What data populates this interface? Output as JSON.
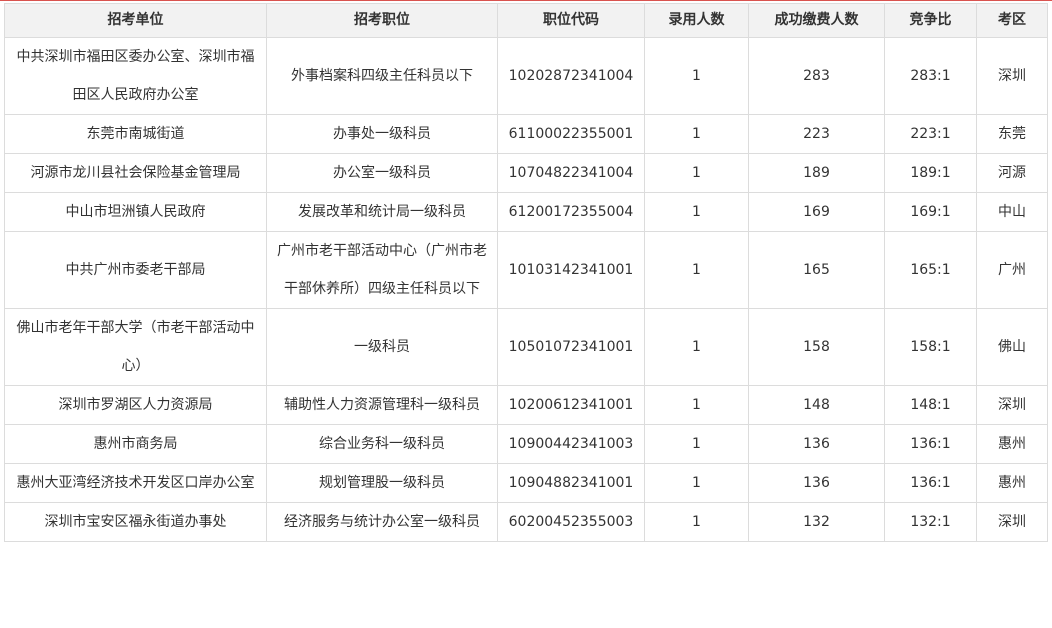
{
  "table": {
    "headers": [
      "招考单位",
      "招考职位",
      "职位代码",
      "录用人数",
      "成功缴费人数",
      "竞争比",
      "考区"
    ],
    "rows": [
      [
        "中共深圳市福田区委办公室、深圳市福田区人民政府办公室",
        "外事档案科四级主任科员以下",
        "10202872341004",
        "1",
        "283",
        "283:1",
        "深圳"
      ],
      [
        "东莞市南城街道",
        "办事处一级科员",
        "61100022355001",
        "1",
        "223",
        "223:1",
        "东莞"
      ],
      [
        "河源市龙川县社会保险基金管理局",
        "办公室一级科员",
        "10704822341004",
        "1",
        "189",
        "189:1",
        "河源"
      ],
      [
        "中山市坦洲镇人民政府",
        "发展改革和统计局一级科员",
        "61200172355004",
        "1",
        "169",
        "169:1",
        "中山"
      ],
      [
        "中共广州市委老干部局",
        "广州市老干部活动中心（广州市老干部休养所）四级主任科员以下",
        "10103142341001",
        "1",
        "165",
        "165:1",
        "广州"
      ],
      [
        "佛山市老年干部大学（市老干部活动中心）",
        "一级科员",
        "10501072341001",
        "1",
        "158",
        "158:1",
        "佛山"
      ],
      [
        "深圳市罗湖区人力资源局",
        "辅助性人力资源管理科一级科员",
        "10200612341001",
        "1",
        "148",
        "148:1",
        "深圳"
      ],
      [
        "惠州市商务局",
        "综合业务科一级科员",
        "10900442341003",
        "1",
        "136",
        "136:1",
        "惠州"
      ],
      [
        "惠州大亚湾经济技术开发区口岸办公室",
        "规划管理股一级科员",
        "10904882341001",
        "1",
        "136",
        "136:1",
        "惠州"
      ],
      [
        "深圳市宝安区福永街道办事处",
        "经济服务与统计办公室一级科员",
        "60200452355003",
        "1",
        "132",
        "132:1",
        "深圳"
      ]
    ]
  }
}
